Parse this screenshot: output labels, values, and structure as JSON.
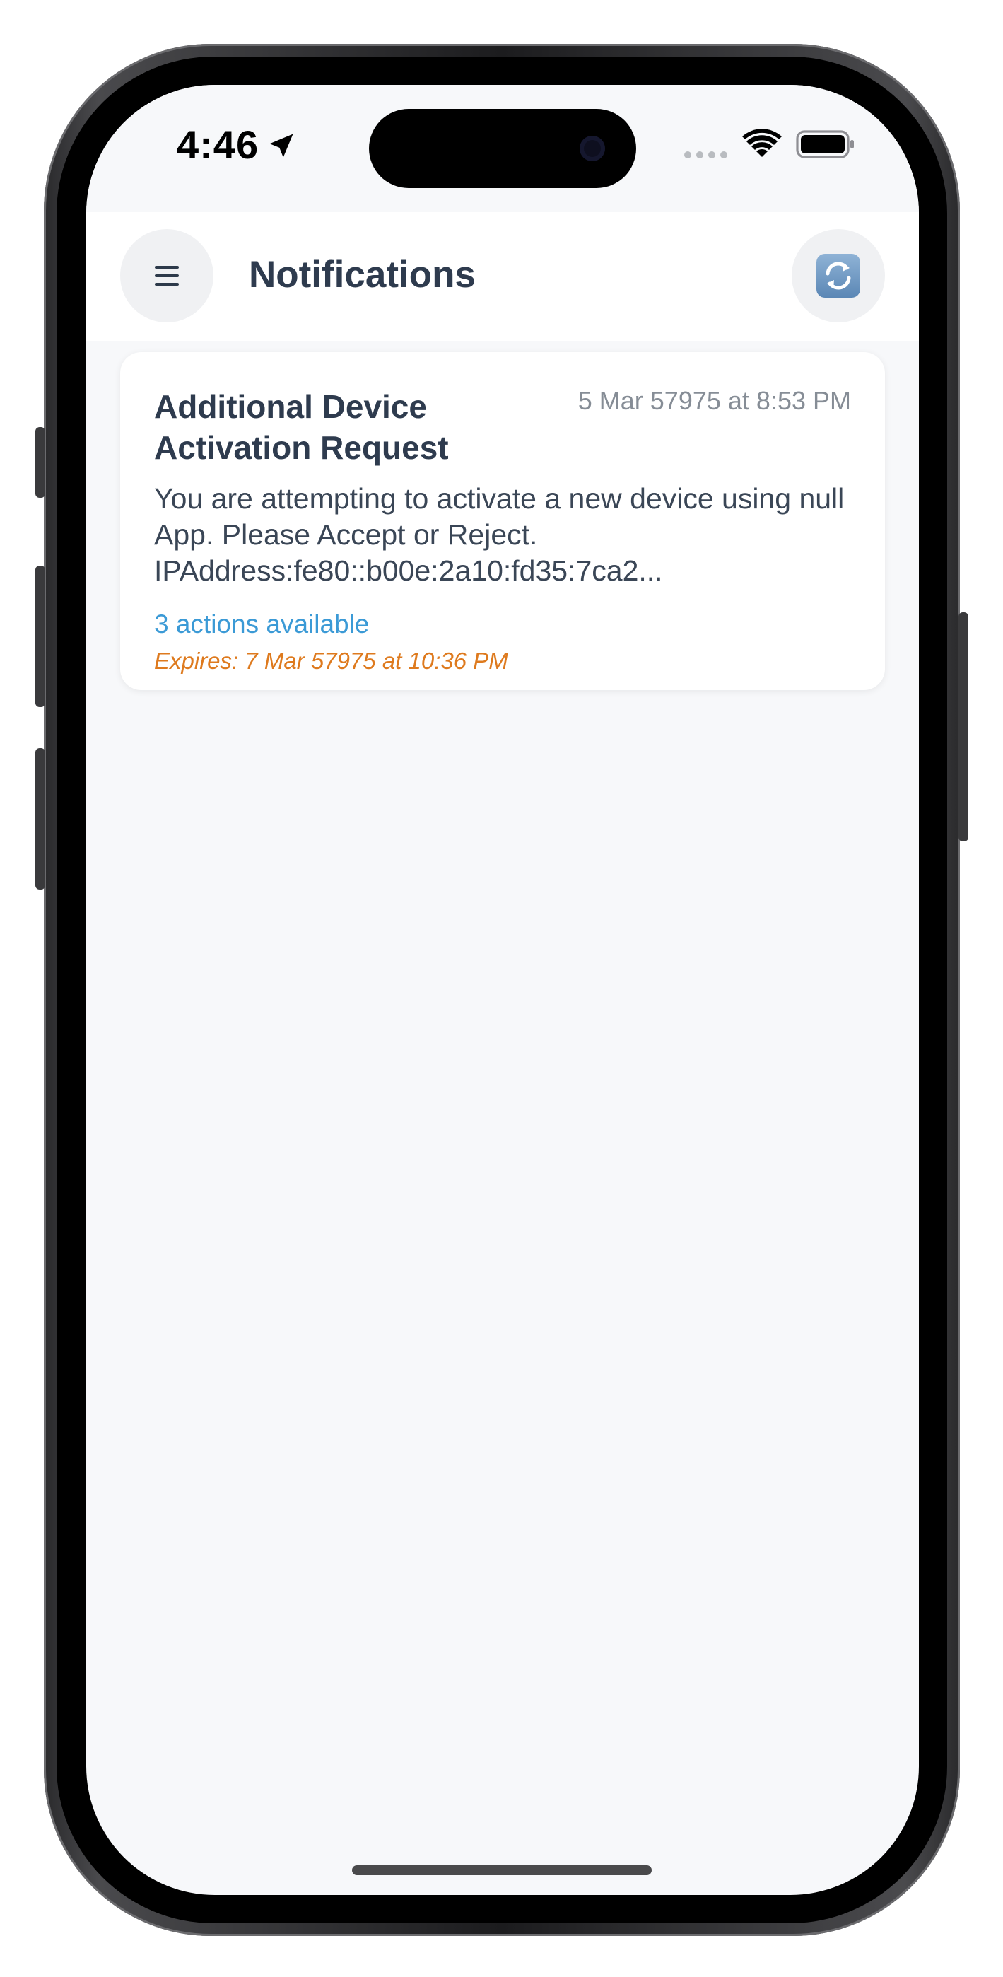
{
  "status_bar": {
    "time": "4:46",
    "location_icon": "location-arrow-icon",
    "wifi_icon": "wifi-icon",
    "battery_icon": "battery-icon"
  },
  "header": {
    "title": "Notifications",
    "menu_icon": "hamburger-menu-icon",
    "refresh_icon": "refresh-icon"
  },
  "notifications": [
    {
      "title": "Additional Device Activation Request",
      "timestamp": "5 Mar 57975 at 8:53 PM",
      "message": "You are attempting to activate a new device using null App. Please Accept or Reject. IPAddress:fe80::b00e:2a10:fd35:7ca2...",
      "actions_label": "3 actions available",
      "expires_label": "Expires: 7 Mar 57975 at 10:36 PM"
    }
  ],
  "colors": {
    "title_text": "#2e3b4e",
    "link_blue": "#3b9ad6",
    "expires_orange": "#de7a1e",
    "timestamp_gray": "#868d96",
    "background": "#f7f8fa"
  }
}
